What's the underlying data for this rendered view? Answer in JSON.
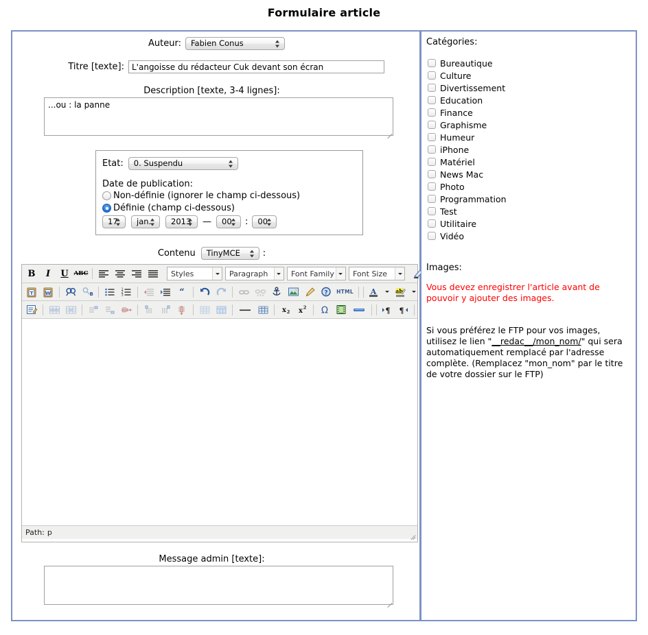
{
  "page": {
    "title": "Formulaire article"
  },
  "form": {
    "author_label": "Auteur:",
    "author_value": "Fabien Conus",
    "title_label": "Titre [texte]:",
    "title_value": "L'angoisse du rédacteur Cuk devant son écran",
    "description_label": "Description [texte, 3-4 lignes]:",
    "description_value": "...ou : la panne",
    "etat_label": "Etat:",
    "etat_value": "0. Suspendu",
    "date_pub_label": "Date de publication:",
    "radio_undefined_label": "Non-définie (ignorer le champ ci-dessous)",
    "radio_defined_label": "Définie (champ ci-dessous)",
    "date_day": "17",
    "date_month": "jan.",
    "date_year": "2013",
    "date_sep": "—",
    "time_hour": "00",
    "time_colon": ":",
    "time_minute": "00",
    "contenu_label": "Contenu",
    "contenu_editor": "TinyMCE",
    "contenu_suffix": ":",
    "message_admin_label": "Message admin [texte]:",
    "message_admin_value": ""
  },
  "editor": {
    "row1": {
      "bold": "B",
      "italic": "I",
      "underline": "U",
      "strikethrough": "ABC",
      "align_left": "align-left-icon",
      "align_center": "align-center-icon",
      "align_right": "align-right-icon",
      "align_justify": "align-justify-icon",
      "styles_label": "Styles",
      "format_label": "Paragraph",
      "fontfamily_label": "Font Family",
      "fontsize_label": "Font Size",
      "cleanup": "eraser-icon"
    },
    "row2_icons": [
      "paste-text-icon",
      "paste-word-icon",
      "search-icon",
      "search-replace-icon",
      "bullet-list-icon",
      "numbered-list-icon",
      "outdent-icon",
      "indent-icon",
      "blockquote-icon",
      "undo-icon",
      "redo-icon",
      "link-icon",
      "unlink-icon",
      "anchor-icon",
      "image-icon",
      "cleanup-brush-icon",
      "help-icon",
      "html-icon",
      "forecolor-icon",
      "backcolor-icon"
    ],
    "row2_html_label": "HTML",
    "row3_icons": [
      "edit-css-icon",
      "table-row-props-icon",
      "table-cell-props-icon",
      "row-insert-before-icon",
      "row-insert-after-icon",
      "row-delete-icon",
      "col-insert-before-icon",
      "col-insert-after-icon",
      "col-delete-icon",
      "split-cells-icon",
      "merge-cells-icon",
      "horizontal-rule-icon",
      "table-icon",
      "subscript-icon",
      "superscript-icon",
      "charmap-icon",
      "media-icon",
      "pagebreak-icon",
      "ltr-icon",
      "rtl-icon"
    ],
    "status_label": "Path:",
    "status_value": "p",
    "content": ""
  },
  "sidebar": {
    "categories_label": "Catégories:",
    "categories": [
      {
        "label": "Bureautique",
        "checked": false
      },
      {
        "label": "Culture",
        "checked": false
      },
      {
        "label": "Divertissement",
        "checked": false
      },
      {
        "label": "Education",
        "checked": false
      },
      {
        "label": "Finance",
        "checked": false
      },
      {
        "label": "Graphisme",
        "checked": false
      },
      {
        "label": "Humeur",
        "checked": false
      },
      {
        "label": "iPhone",
        "checked": false
      },
      {
        "label": "Matériel",
        "checked": false
      },
      {
        "label": "News Mac",
        "checked": false
      },
      {
        "label": "Photo",
        "checked": false
      },
      {
        "label": "Programmation",
        "checked": false
      },
      {
        "label": "Test",
        "checked": false
      },
      {
        "label": "Utilitaire",
        "checked": false
      },
      {
        "label": "Vidéo",
        "checked": false
      }
    ],
    "images_label": "Images:",
    "images_warning": "Vous devez enregistrer l'article avant de pouvoir y ajouter des images.",
    "ftp_text_1": "Si vous préférez le FTP pour vos images, utilisez le lien \"",
    "ftp_link": "__redac__/mon_nom/",
    "ftp_text_2": "\" qui sera automatiquement remplacé par l'adresse complète. (Remplacez \"mon_nom\" par le titre de votre dossier sur le FTP)"
  },
  "colors": {
    "panel_border": "#7b93c4",
    "warning": "#ff0000",
    "toolbar_bg": "#f0f0ee"
  }
}
